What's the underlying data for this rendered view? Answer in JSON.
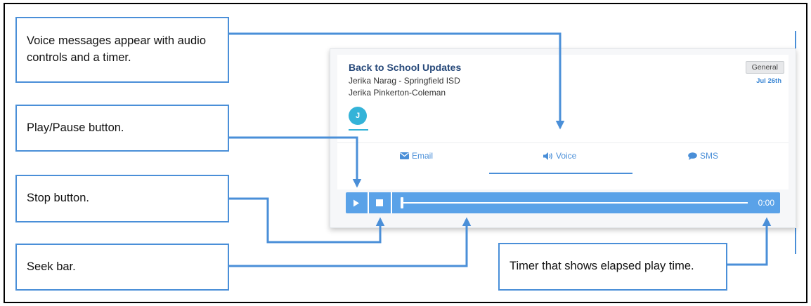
{
  "callouts": {
    "voice_messages": "Voice messages appear with audio controls and a timer.",
    "play_pause": "Play/Pause button.",
    "stop": "Stop button.",
    "seek": "Seek bar.",
    "timer": "Timer that shows elapsed play time."
  },
  "message": {
    "title": "Back to School Updates",
    "sender_line1": "Jerika Narag - Springfield ISD",
    "sender_line2": "Jerika Pinkerton-Coleman",
    "badge": "General",
    "date": "Jul 26th",
    "avatar_initial": "J"
  },
  "tabs": [
    {
      "label": "Email",
      "icon": "envelope-icon"
    },
    {
      "label": "Voice",
      "icon": "speaker-icon"
    },
    {
      "label": "SMS",
      "icon": "chat-bubble-icon"
    }
  ],
  "active_tab": "Voice",
  "player": {
    "time": "0:00",
    "progress": 0,
    "play_icon": "play-icon",
    "stop_icon": "stop-icon"
  },
  "colors": {
    "accent": "#4a8fd8",
    "player_bg": "#5aa2e8",
    "title": "#27497a",
    "avatar": "#34b3d8"
  }
}
